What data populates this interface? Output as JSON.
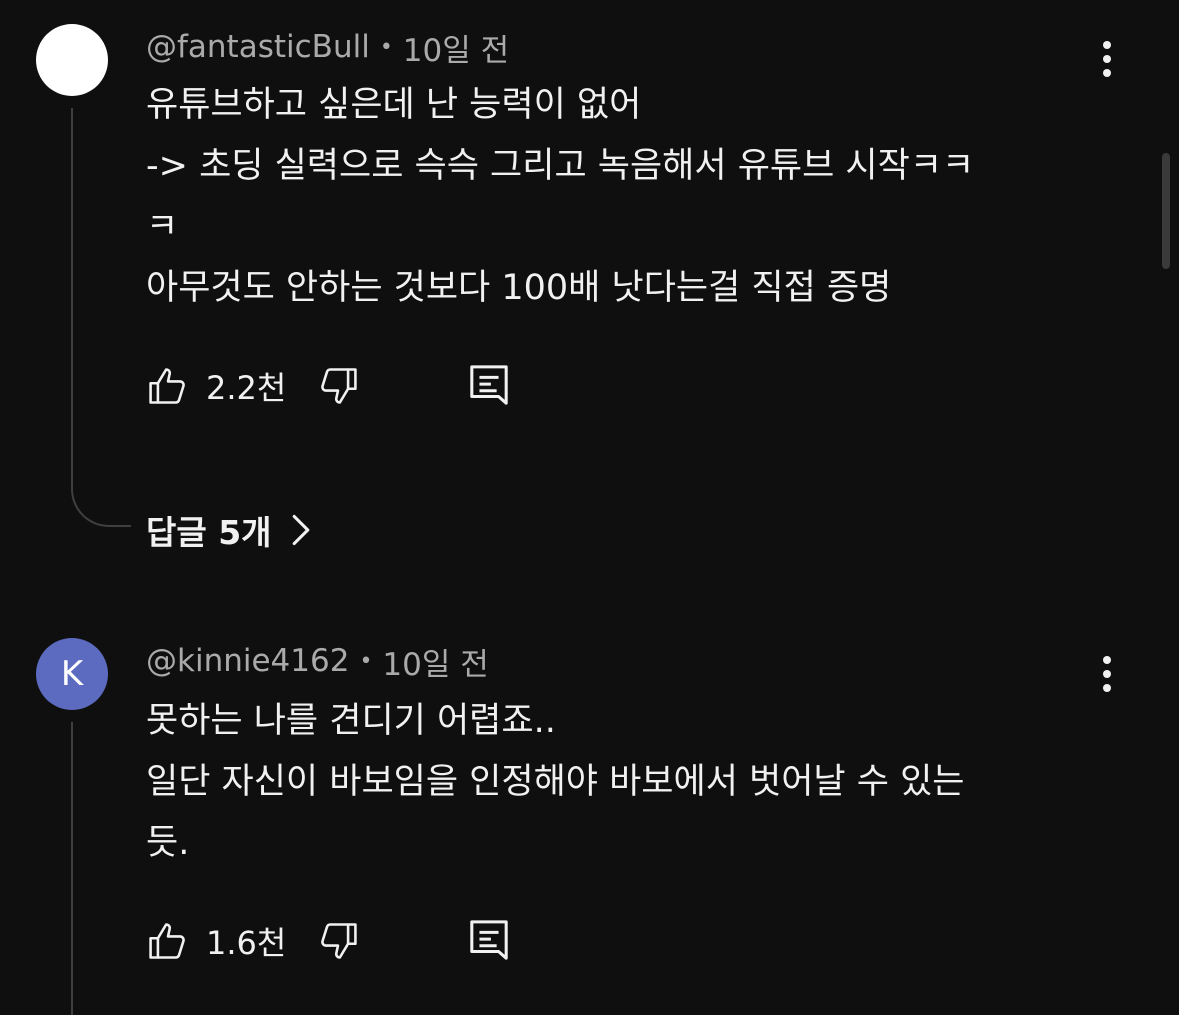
{
  "comments": [
    {
      "author": "@fantasticBull",
      "time": "10일 전",
      "avatar_letter": "",
      "avatar_color": "#ffffff",
      "lines": [
        "유튜브하고 싶은데 난 능력이 없어",
        "-> 초딩 실력으로 슥슥 그리고 녹음해서 유튜브 시작ㅋㅋ",
        "ㅋ",
        "아무것도 안하는 것보다 100배 낫다는걸 직접 증명"
      ],
      "likes": "2.2천",
      "replies_label": "답글 5개"
    },
    {
      "author": "@kinnie4162",
      "time": "10일 전",
      "avatar_letter": "K",
      "avatar_color": "#5c6bc0",
      "lines": [
        "못하는 나를 견디기 어렵죠..",
        "일단 자신이 바보임을 인정해야 바보에서 벗어날 수 있는",
        "듯."
      ],
      "likes": "1.6천"
    }
  ],
  "icons": {
    "like": "thumbs-up-icon",
    "dislike": "thumbs-down-icon",
    "reply": "comment-reply-icon",
    "more": "more-vertical-icon",
    "chevron": "chevron-right-icon"
  },
  "colors": {
    "background": "#0f0f0f",
    "text": "#f1f1f1",
    "secondary_text": "#aaaaaa",
    "thread_line": "#3f3f3f"
  }
}
